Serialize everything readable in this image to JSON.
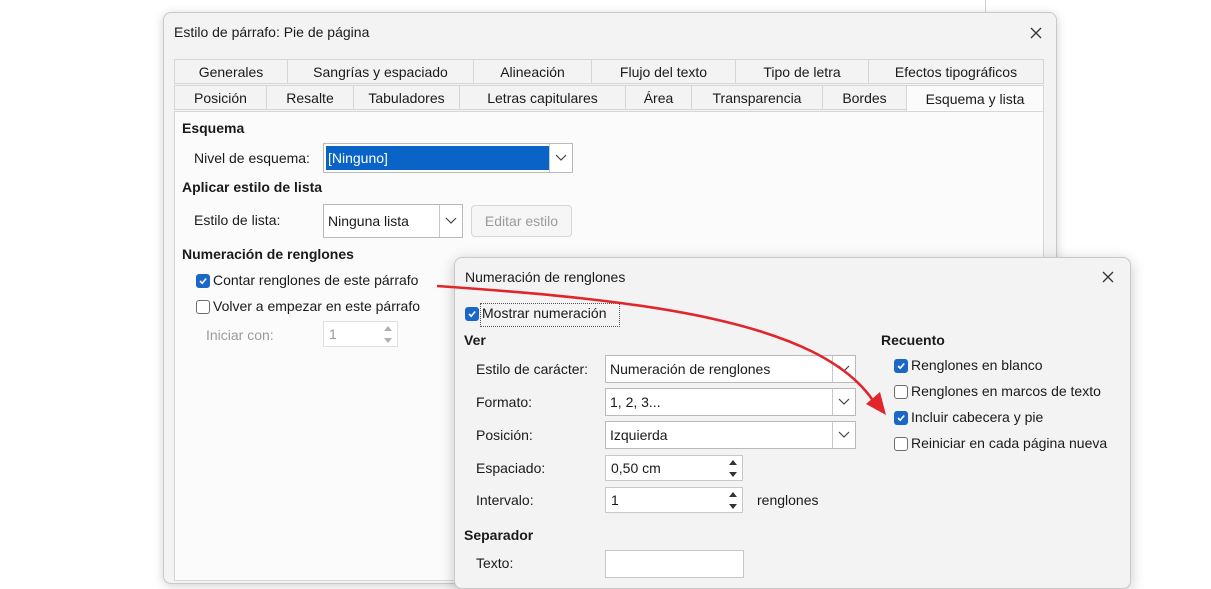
{
  "paragraph_dialog": {
    "title": "Estilo de párrafo: Pie de página",
    "tabs_row1": [
      "Generales",
      "Sangrías y espaciado",
      "Alineación",
      "Flujo del texto",
      "Tipo de letra",
      "Efectos tipográficos"
    ],
    "tabs_row2": [
      "Posición",
      "Resalte",
      "Tabuladores",
      "Letras capitulares",
      "Área",
      "Transparencia",
      "Bordes",
      "Esquema y lista"
    ],
    "active_tab": "Esquema y lista",
    "outline": {
      "heading": "Esquema",
      "level_label": "Nivel de esquema:",
      "level_value": "[Ninguno]"
    },
    "list_style": {
      "heading": "Aplicar estilo de lista",
      "label": "Estilo de lista:",
      "value": "Ninguna lista",
      "edit_button": "Editar estilo"
    },
    "line_numbering": {
      "heading": "Numeración de renglones",
      "count_lines": {
        "label": "Contar renglones de este párrafo",
        "checked": true
      },
      "restart": {
        "label": "Volver a empezar en este párrafo",
        "checked": false
      },
      "start_with_label": "Iniciar con:",
      "start_with_value": "1"
    }
  },
  "line_numbering_dialog": {
    "title": "Numeración de renglones",
    "show_numbering": {
      "label": "Mostrar numeración",
      "checked": true
    },
    "view": {
      "heading": "Ver",
      "char_style_label": "Estilo de carácter:",
      "char_style_value": "Numeración de renglones",
      "format_label": "Formato:",
      "format_value": "1, 2, 3...",
      "position_label": "Posición:",
      "position_value": "Izquierda",
      "spacing_label": "Espaciado:",
      "spacing_value": "0,50 cm",
      "interval_label": "Intervalo:",
      "interval_value": "1",
      "interval_unit": "renglones"
    },
    "count": {
      "heading": "Recuento",
      "options": [
        {
          "label": "Renglones en blanco",
          "checked": true
        },
        {
          "label": "Renglones en marcos de texto",
          "checked": false
        },
        {
          "label": "Incluir cabecera y pie",
          "checked": true
        },
        {
          "label": "Reiniciar en cada página nueva",
          "checked": false
        }
      ]
    },
    "separator": {
      "heading": "Separador",
      "text_label": "Texto:",
      "text_value": ""
    }
  },
  "annotation": {
    "arrow_color": "#e0262b"
  },
  "colors": {
    "accent": "#1b67c8",
    "selection": "#0a64c8"
  }
}
